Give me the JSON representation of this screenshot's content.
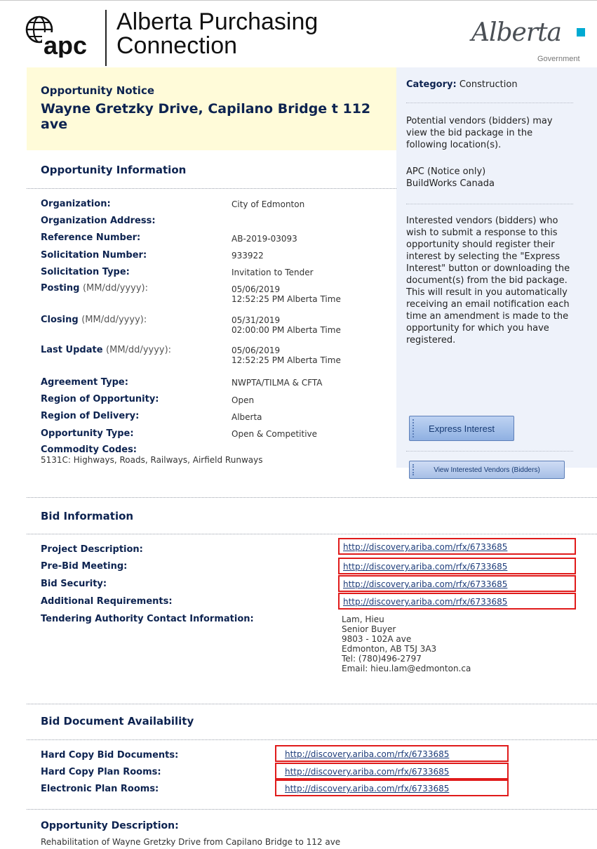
{
  "header": {
    "logo_text": "apc",
    "title_line1": "Alberta Purchasing",
    "title_line2": "Connection",
    "gov_logo_word": "Alberta",
    "gov_logo_sub": "Government"
  },
  "notice": {
    "label": "Opportunity Notice",
    "title": "Wayne Gretzky Drive, Capilano Bridge t 112 ave"
  },
  "sidebar": {
    "category_label": "Category:",
    "category_value": "Construction",
    "view_text": "Potential vendors (bidders) may view the bid package in the following location(s).",
    "locations": [
      "APC (Notice only)",
      "BuildWorks Canada"
    ],
    "interest_text": "Interested vendors (bidders) who wish to submit a response to this opportunity should register their interest by selecting the \"Express Interest\" button or downloading the document(s) from the bid package. This will result in you automatically receiving an email notification each time an amendment is made to the opportunity for which you have registered.",
    "express_interest_button": "Express Interest",
    "view_vendors_button": "View Interested Vendors (Bidders)"
  },
  "opportunity_info": {
    "heading": "Opportunity Information",
    "organization_label": "Organization:",
    "organization_value": "City of Edmonton",
    "org_address_label": "Organization Address:",
    "reference_label": "Reference Number:",
    "reference_value": "AB-2019-03093",
    "solicitation_number_label": "Solicitation Number:",
    "solicitation_number_value": "933922",
    "solicitation_type_label": "Solicitation Type:",
    "solicitation_type_value": "Invitation to Tender",
    "posting_label": "Posting",
    "posting_hint": "(MM/dd/yyyy):",
    "posting_date": "05/06/2019",
    "posting_time": "12:52:25 PM Alberta Time",
    "closing_label": "Closing",
    "closing_hint": "(MM/dd/yyyy):",
    "closing_date": "05/31/2019",
    "closing_time": "02:00:00 PM Alberta Time",
    "last_update_label": "Last Update",
    "last_update_hint": "(MM/dd/yyyy):",
    "last_update_date": "05/06/2019",
    "last_update_time": "12:52:25 PM Alberta Time",
    "agreement_label": "Agreement Type:",
    "agreement_value": "NWPTA/TILMA & CFTA",
    "region_opportunity_label": "Region of Opportunity:",
    "region_opportunity_value": "Open",
    "region_delivery_label": "Region of Delivery:",
    "region_delivery_value": "Alberta",
    "opportunity_type_label": "Opportunity Type:",
    "opportunity_type_value": "Open & Competitive",
    "commodity_label": "Commodity Codes:",
    "commodity_value": "5131C: Highways, Roads, Railways, Airfield Runways"
  },
  "bid_info": {
    "heading": "Bid Information",
    "project_description_label": "Project Description:",
    "project_description_link": "http://discovery.ariba.com/rfx/6733685",
    "pre_bid_label": "Pre-Bid Meeting:",
    "pre_bid_link": "http://discovery.ariba.com/rfx/6733685",
    "bid_security_label": "Bid Security:",
    "bid_security_link": "http://discovery.ariba.com/rfx/6733685",
    "additional_label": "Additional Requirements:",
    "additional_link": "http://discovery.ariba.com/rfx/6733685",
    "contact_label": "Tendering Authority Contact Information:",
    "contact_lines": [
      "Lam, Hieu",
      "Senior Buyer",
      "9803 - 102A ave",
      "Edmonton, AB T5J 3A3",
      "Tel: (780)496-2797",
      "Email: hieu.lam@edmonton.ca"
    ]
  },
  "bid_docs": {
    "heading": "Bid Document Availability",
    "hard_copy_docs_label": "Hard Copy Bid Documents:",
    "hard_copy_docs_link": "http://discovery.ariba.com/rfx/6733685",
    "hard_copy_plan_label": "Hard Copy Plan Rooms:",
    "hard_copy_plan_link": "http://discovery.ariba.com/rfx/6733685",
    "electronic_plan_label": "Electronic Plan Rooms:",
    "electronic_plan_link": "http://discovery.ariba.com/rfx/6733685"
  },
  "description": {
    "heading": "Opportunity Description:",
    "text": "Rehabilitation of Wayne Gretzky Drive from Capilano Bridge to 112 ave"
  }
}
